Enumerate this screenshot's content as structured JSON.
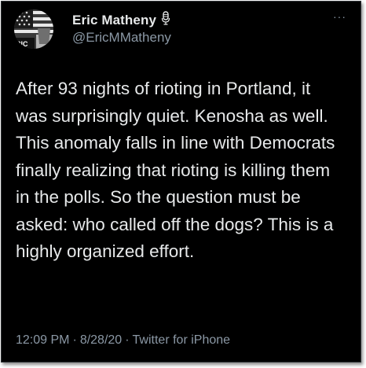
{
  "author": {
    "display_name": "Eric Matheny",
    "handle": "@EricMMatheny",
    "avatar_icon": "flag-avatar-icon",
    "avatar_text": "RIC",
    "name_badge_icon": "microphone-icon"
  },
  "more_menu": {
    "icon": "more-dots-icon",
    "glyph": "···"
  },
  "tweet": {
    "text": "After 93 nights of rioting in Portland, it was surprisingly quiet. Kenosha as well. This anomaly falls in line with Democrats finally realizing that rioting is killing them in the polls. So the question must be asked: who called off the dogs? This is a highly organized effort.",
    "time": "12:09 PM",
    "date": "8/28/20",
    "source": "Twitter for iPhone",
    "separator": "·"
  },
  "colors": {
    "background": "#000000",
    "primary_text": "#e7e9ea",
    "secondary_text": "#8b98a5"
  }
}
